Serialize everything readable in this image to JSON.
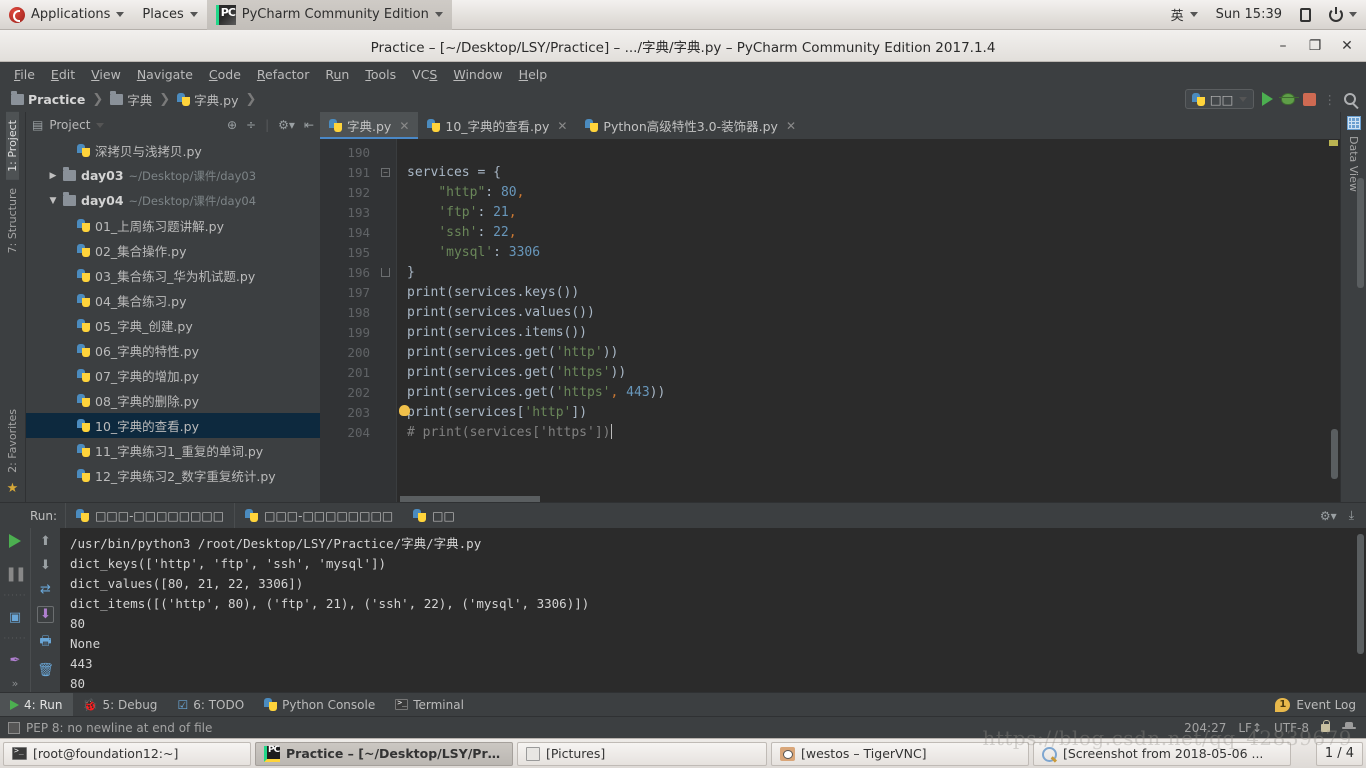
{
  "desktop": {
    "panel": {
      "applications": "Applications",
      "places": "Places",
      "app_title": "PyCharm Community Edition",
      "input_method": "英",
      "clock": "Sun 15:39"
    },
    "taskbar": {
      "items": [
        {
          "label": "[root@foundation12:~]",
          "icon": "terminal-icon",
          "active": false
        },
        {
          "label": "Practice – [~/Desktop/LSY/Practi...",
          "icon": "pycharm-icon",
          "active": true
        },
        {
          "label": "[Pictures]",
          "icon": "pictures-icon",
          "active": false
        },
        {
          "label": "[westos – TigerVNC]",
          "icon": "vnc-icon",
          "active": false
        },
        {
          "label": "[Screenshot from 2018-05-06 ...",
          "icon": "screenshot-icon",
          "active": false
        }
      ],
      "pager": "1 / 4"
    },
    "watermark": "https://blog.csdn.net/qq_42839679"
  },
  "window": {
    "title": "Practice – [~/Desktop/LSY/Practice] – .../字典/字典.py – PyCharm Community Edition 2017.1.4",
    "buttons": {
      "minimize": "–",
      "maximize": "❐",
      "close": "✕"
    }
  },
  "menubar": {
    "items": [
      "File",
      "Edit",
      "View",
      "Navigate",
      "Code",
      "Refactor",
      "Run",
      "Tools",
      "VCS",
      "Window",
      "Help"
    ]
  },
  "navbar": {
    "breadcrumbs": [
      {
        "label": "Practice",
        "icon": "folder-icon"
      },
      {
        "label": "字典",
        "icon": "folder-icon"
      },
      {
        "label": "字典.py",
        "icon": "python-file-icon"
      }
    ],
    "run_config": "□□",
    "actions": [
      "run-button",
      "debug-button",
      "stop-button",
      "search-everywhere-button"
    ]
  },
  "left_strip": {
    "project": "1: Project",
    "structure": "7: Structure",
    "favorites": "2: Favorites"
  },
  "right_strip": {
    "data_view": "Data View"
  },
  "project_panel": {
    "title": "Project",
    "tree": [
      {
        "label": "深拷贝与浅拷贝.py",
        "indent": 2,
        "arrow": "",
        "icon": "python-file-icon",
        "bold": false,
        "note": "",
        "selected": false
      },
      {
        "label": "day03",
        "indent": 1,
        "arrow": "▶",
        "icon": "folder-icon",
        "bold": true,
        "note": "~/Desktop/课件/day03",
        "selected": false
      },
      {
        "label": "day04",
        "indent": 1,
        "arrow": "▼",
        "icon": "folder-icon",
        "bold": true,
        "note": "~/Desktop/课件/day04",
        "selected": false
      },
      {
        "label": "01_上周练习题讲解.py",
        "indent": 2,
        "arrow": "",
        "icon": "python-file-icon",
        "bold": false,
        "note": "",
        "selected": false
      },
      {
        "label": "02_集合操作.py",
        "indent": 2,
        "arrow": "",
        "icon": "python-file-icon",
        "bold": false,
        "note": "",
        "selected": false
      },
      {
        "label": "03_集合练习_华为机试题.py",
        "indent": 2,
        "arrow": "",
        "icon": "python-file-icon",
        "bold": false,
        "note": "",
        "selected": false
      },
      {
        "label": "04_集合练习.py",
        "indent": 2,
        "arrow": "",
        "icon": "python-file-icon",
        "bold": false,
        "note": "",
        "selected": false
      },
      {
        "label": "05_字典_创建.py",
        "indent": 2,
        "arrow": "",
        "icon": "python-file-icon",
        "bold": false,
        "note": "",
        "selected": false
      },
      {
        "label": "06_字典的特性.py",
        "indent": 2,
        "arrow": "",
        "icon": "python-file-icon",
        "bold": false,
        "note": "",
        "selected": false
      },
      {
        "label": "07_字典的增加.py",
        "indent": 2,
        "arrow": "",
        "icon": "python-file-icon",
        "bold": false,
        "note": "",
        "selected": false
      },
      {
        "label": "08_字典的删除.py",
        "indent": 2,
        "arrow": "",
        "icon": "python-file-icon",
        "bold": false,
        "note": "",
        "selected": false
      },
      {
        "label": "10_字典的查看.py",
        "indent": 2,
        "arrow": "",
        "icon": "python-file-icon",
        "bold": false,
        "note": "",
        "selected": true
      },
      {
        "label": "11_字典练习1_重复的单词.py",
        "indent": 2,
        "arrow": "",
        "icon": "python-file-icon",
        "bold": false,
        "note": "",
        "selected": false
      },
      {
        "label": "12_字典练习2_数字重复统计.py",
        "indent": 2,
        "arrow": "",
        "icon": "python-file-icon",
        "bold": false,
        "note": "",
        "selected": false
      }
    ]
  },
  "editor": {
    "tabs": [
      {
        "label": "字典.py",
        "active": true
      },
      {
        "label": "10_字典的查看.py",
        "active": false
      },
      {
        "label": "Python高级特性3.0-装饰器.py",
        "active": false
      }
    ],
    "first_line_number": 190,
    "lines": [
      {
        "no": 190,
        "text": "",
        "fold": ""
      },
      {
        "no": 191,
        "text": "services = {",
        "fold": "minus"
      },
      {
        "no": 192,
        "text": "    \"http\": 80,",
        "fold": ""
      },
      {
        "no": 193,
        "text": "    'ftp': 21,",
        "fold": ""
      },
      {
        "no": 194,
        "text": "    'ssh': 22,",
        "fold": ""
      },
      {
        "no": 195,
        "text": "    'mysql': 3306",
        "fold": ""
      },
      {
        "no": 196,
        "text": "}",
        "fold": "end"
      },
      {
        "no": 197,
        "text": "print(services.keys())",
        "fold": ""
      },
      {
        "no": 198,
        "text": "print(services.values())",
        "fold": ""
      },
      {
        "no": 199,
        "text": "print(services.items())",
        "fold": ""
      },
      {
        "no": 200,
        "text": "print(services.get('http'))",
        "fold": ""
      },
      {
        "no": 201,
        "text": "print(services.get('https'))",
        "fold": ""
      },
      {
        "no": 202,
        "text": "print(services.get('https', 443))",
        "fold": ""
      },
      {
        "no": 203,
        "text": "print(services['http'])",
        "fold": ""
      },
      {
        "no": 204,
        "text": "# print(services['https'])",
        "fold": ""
      }
    ]
  },
  "run_panel": {
    "label": "Run:",
    "tabs": [
      {
        "label": "□□□-□□□□□□□□",
        "icon": "python-run-icon"
      },
      {
        "label": "□□□-□□□□□□□□",
        "icon": "python-run-icon"
      },
      {
        "label": "□□",
        "icon": "python-icon"
      }
    ],
    "console_lines": [
      "/usr/bin/python3 /root/Desktop/LSY/Practice/字典/字典.py",
      "dict_keys(['http', 'ftp', 'ssh', 'mysql'])",
      "dict_values([80, 21, 22, 3306])",
      "dict_items([('http', 80), ('ftp', 21), ('ssh', 22), ('mysql', 3306)])",
      "80",
      "None",
      "443",
      "80"
    ]
  },
  "tool_window_bar": {
    "items": [
      {
        "label": "4: Run",
        "icon": "run-icon",
        "selected": true
      },
      {
        "label": "5: Debug",
        "icon": "debug-icon",
        "selected": false
      },
      {
        "label": "6: TODO",
        "icon": "todo-icon",
        "selected": false
      },
      {
        "label": "Python Console",
        "icon": "python-icon",
        "selected": false
      },
      {
        "label": "Terminal",
        "icon": "terminal-icon",
        "selected": false
      }
    ],
    "event_log": {
      "label": "Event Log",
      "count": "1"
    }
  },
  "statusbar": {
    "message": "PEP 8: no newline at end of file",
    "caret": "204:27",
    "line_separator": "LF↕",
    "encoding": "UTF-8"
  }
}
